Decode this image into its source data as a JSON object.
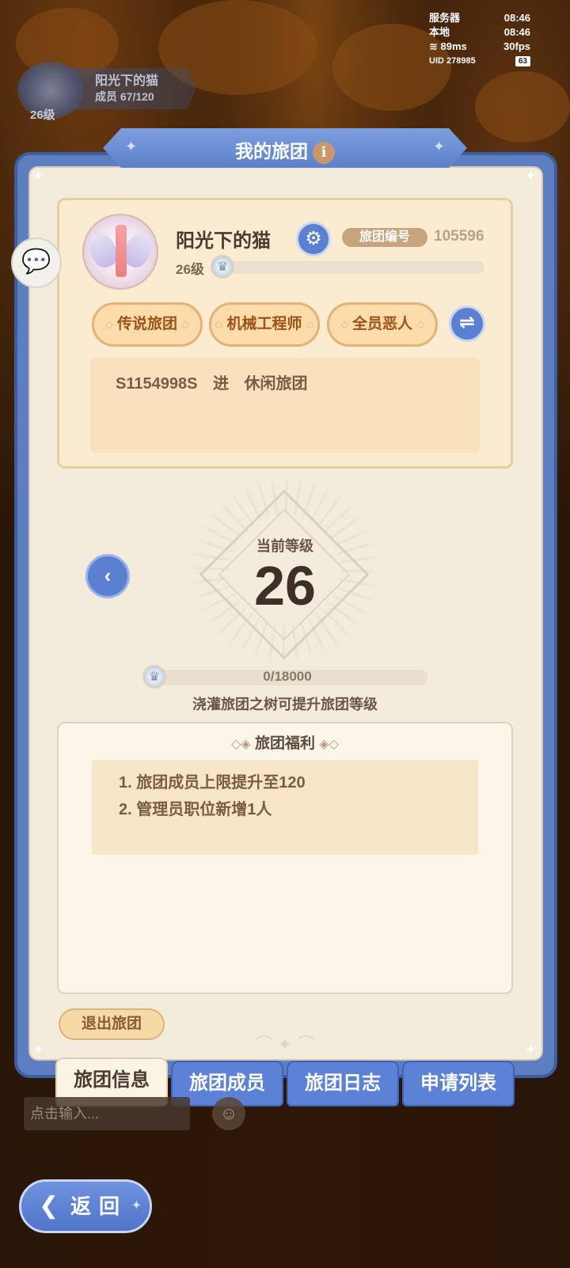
{
  "status": {
    "server_label": "服务器",
    "server_time": "08:46",
    "local_label": "本地",
    "local_time": "08:46",
    "ping": "89ms",
    "fps": "30fps",
    "uid": "UID 278985",
    "battery": "63"
  },
  "top_guild": {
    "name": "阳光下的猫",
    "members": "成员  67/120",
    "level": "26级"
  },
  "panel": {
    "title": "我的旅团",
    "info_icon": "i"
  },
  "guild": {
    "name": "阳光下的猫",
    "id_label": "旅团编号",
    "id_value": "105596",
    "level": "26级",
    "level_progress": 0.0,
    "tags": [
      "传说旅团",
      "机械工程师",
      "全员恶人"
    ],
    "notice": "S1154998S 进 休闲旅团"
  },
  "level_section": {
    "current_label": "当前等级",
    "current_value": "26",
    "xp_text": "0/18000",
    "xp_progress": 0.0,
    "hint": "浇灌旅团之树可提升旅团等级"
  },
  "benefits": {
    "title": "旅团福利",
    "items": [
      "1.  旅团成员上限提升至120",
      "2.  管理员职位新增1人"
    ]
  },
  "actions": {
    "quit": "退出旅团",
    "back": "返回"
  },
  "tabs": [
    {
      "label": "旅团信息",
      "active": true
    },
    {
      "label": "旅团成员",
      "active": false
    },
    {
      "label": "旅团日志",
      "active": false
    },
    {
      "label": "申请列表",
      "active": false
    }
  ],
  "chat": {
    "placeholder": "点击输入..."
  },
  "colors": {
    "panel_blue": "#5d7fc1",
    "panel_cream": "#f3ecdc",
    "tag_orange": "#fbdcaa",
    "tab_blue": "#5b82d6"
  },
  "icons": {
    "gear": "gear-icon",
    "swap": "swap-icon",
    "prev": "chevron-left-icon",
    "chat": "chat-bubble-icon",
    "emoji": "emoji-icon",
    "back": "back-arrow-icon"
  }
}
